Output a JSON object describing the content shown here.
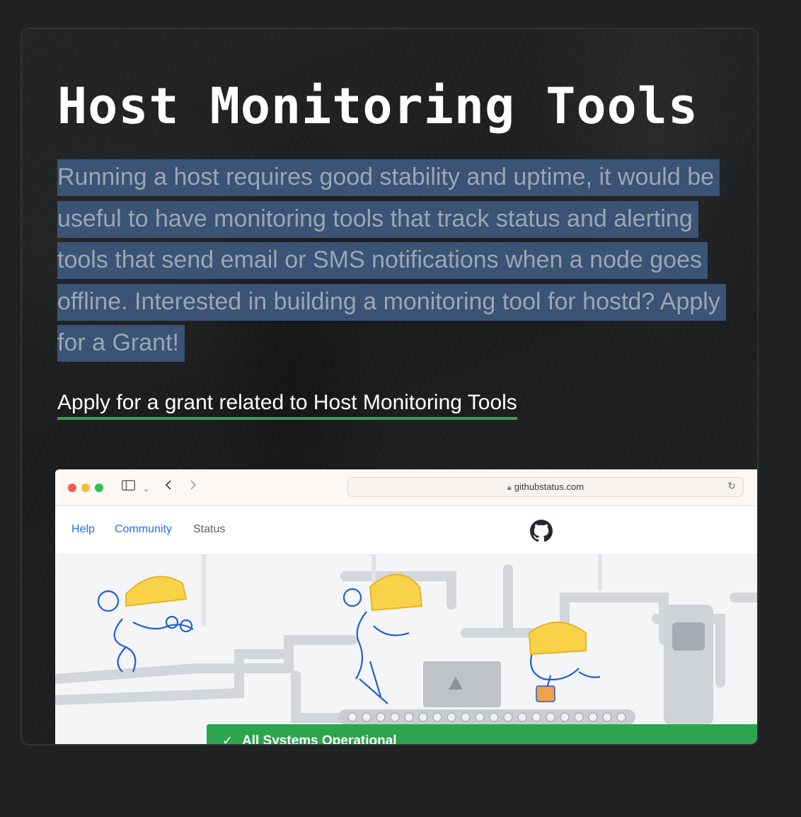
{
  "card": {
    "title": "Host Monitoring Tools",
    "description": "Running a host requires good stability and uptime, it would be useful to have monitoring tools that track status and alerting tools that send email or SMS notifications when a node goes offline. Interested in building a monitoring tool for hostd? Apply for a Grant!",
    "link_label": "Apply for a grant related to Host Monitoring Tools"
  },
  "browser": {
    "url": "githubstatus.com",
    "icons": [
      "sidebar-icon",
      "chevron-down-icon",
      "back-icon",
      "forward-icon",
      "lock-icon",
      "reload-icon"
    ],
    "nav": {
      "help": "Help",
      "community": "Community",
      "status": "Status"
    },
    "status_banner": "All Systems Operational"
  },
  "colors": {
    "page_background": "#1f2123",
    "highlight": "#3b5374",
    "link_underline": "#2ba84a",
    "nav_link": "#1f6feb",
    "status_green": "#2da44e"
  }
}
